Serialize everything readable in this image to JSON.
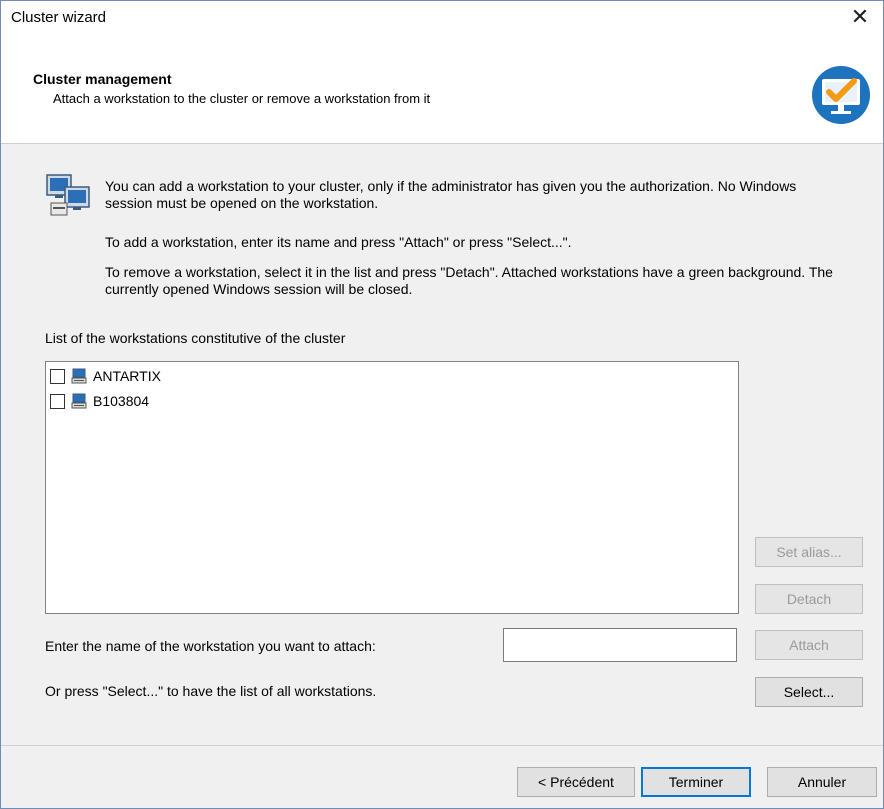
{
  "window": {
    "title": "Cluster wizard",
    "close_glyph": "✕"
  },
  "header": {
    "title": "Cluster management",
    "subtitle": "Attach a workstation to the cluster or remove a workstation from it",
    "icon": "monitor-check-icon"
  },
  "info": {
    "icon": "workstations-icon",
    "p1": "You can add a workstation to your cluster, only if the administrator has given you the authorization. No Windows session must be opened on the workstation.",
    "p2": "To add a workstation, enter its name and press \"Attach\" or press \"Select...\".",
    "p3": "To remove a workstation, select it in the list and press \"Detach\". Attached workstations have a green background. The currently opened Windows session will be closed."
  },
  "list": {
    "label": "List of the workstations constitutive of the cluster",
    "items": [
      {
        "name": "ANTARTIX",
        "checked": false
      },
      {
        "name": "B103804",
        "checked": false
      }
    ]
  },
  "buttons": {
    "set_alias": "Set alias...",
    "detach": "Detach",
    "attach": "Attach",
    "select": "Select..."
  },
  "attach_form": {
    "label": "Enter the name of the workstation you want to attach:",
    "value": "",
    "select_hint": "Or press \"Select...\" to have the list of all workstations."
  },
  "footer": {
    "back": "< Précédent",
    "finish": "Terminer",
    "cancel": "Annuler"
  },
  "colors": {
    "accent": "#0078d7",
    "icon_blue": "#1e73be",
    "check_orange": "#f39c12"
  }
}
